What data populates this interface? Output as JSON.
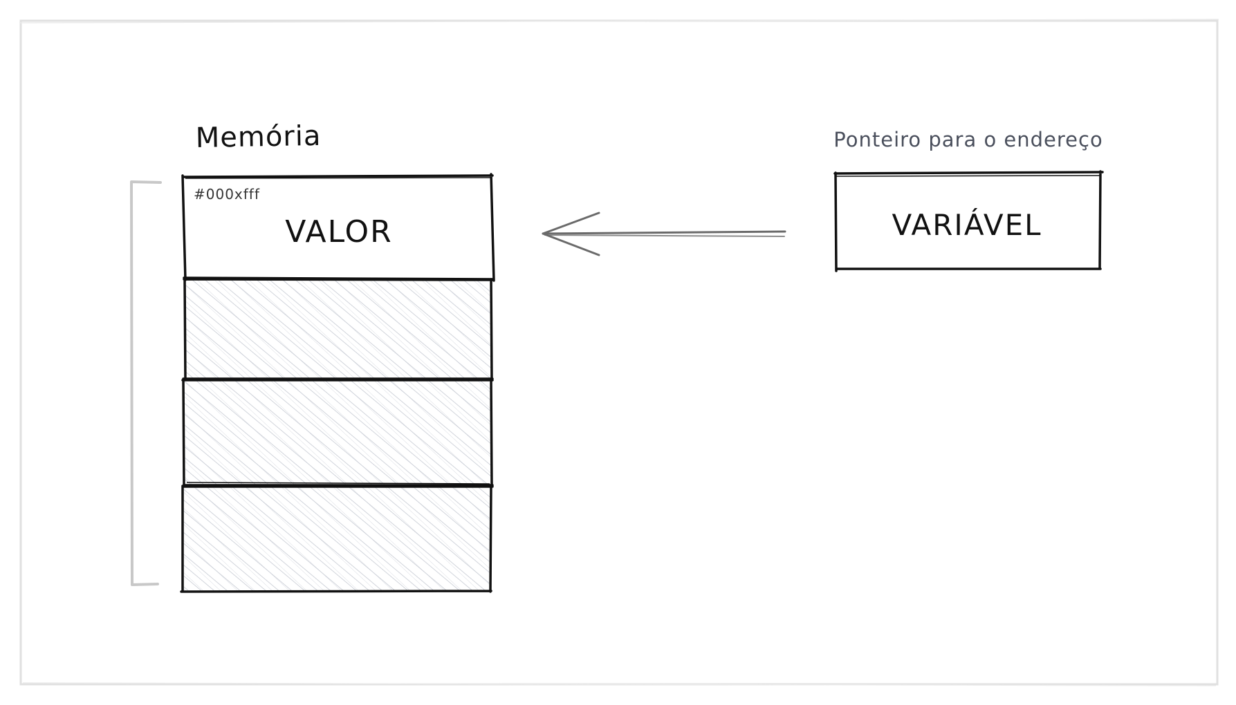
{
  "memory_title": "Memória",
  "memory_address": "#000xfff",
  "memory_value": "VALOR",
  "pointer_caption": "Ponteiro para o endereço",
  "variable_label": "VARIÁVEL",
  "colors": {
    "ink": "#111111",
    "caption": "#4a4f5c",
    "hatch": "#c5c9d2",
    "bracket": "#c8c8c8",
    "arrow": "#6a6a6a",
    "frame": "#e0e0e0"
  }
}
